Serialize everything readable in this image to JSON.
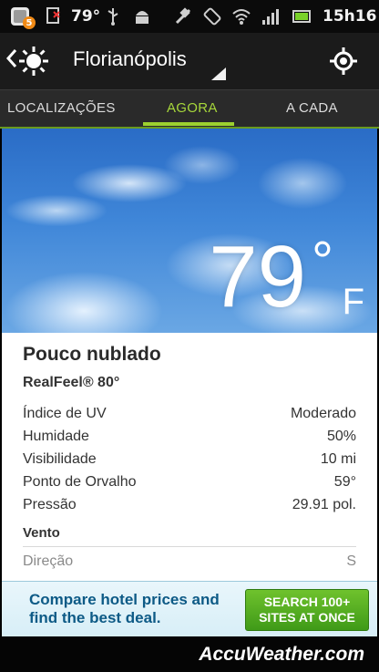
{
  "status_bar": {
    "notification_count": "5",
    "temperature": "79°",
    "time": "15h16",
    "icons": [
      "accuweather-notification-icon",
      "sim-missing-icon",
      "usb-icon",
      "android-debug-icon",
      "gps-icon",
      "rotate-icon",
      "wifi-icon",
      "signal-icon",
      "battery-icon"
    ]
  },
  "header": {
    "location": "Florianópolis",
    "icons": [
      "back-chevron-icon",
      "sun-icon",
      "dropdown-caret-icon",
      "locate-icon"
    ]
  },
  "tabs": [
    {
      "label": "LOCALIZAÇÕES",
      "active": false
    },
    {
      "label": "AGORA",
      "active": true
    },
    {
      "label": "A CADA HORA",
      "active": false
    }
  ],
  "current": {
    "temperature": "79",
    "degree": "°",
    "unit": "F",
    "condition": "Pouco nublado",
    "realfeel": "RealFeel® 80°"
  },
  "details": [
    {
      "label": "Índice de UV",
      "value": "Moderado"
    },
    {
      "label": "Humidade",
      "value": "50%"
    },
    {
      "label": "Visibilidade",
      "value": "10 mi"
    },
    {
      "label": "Ponto de Orvalho",
      "value": "59°"
    },
    {
      "label": "Pressão",
      "value": "29.91 pol."
    }
  ],
  "wind": {
    "title": "Vento",
    "rows": [
      {
        "label": "Direção",
        "value": "S"
      }
    ]
  },
  "ad": {
    "text": "Compare hotel prices and find the best deal.",
    "button": "SEARCH 100+ SITES AT ONCE"
  },
  "footer": {
    "brand": "AccuWeather.com"
  },
  "colors": {
    "accent": "#9dd12f",
    "status_bar": "#0b0b0b",
    "header": "#1b1b1b",
    "tabs": "#2a2a2a",
    "ad_button": "#4fae1f",
    "ad_text": "#0d5a86"
  }
}
